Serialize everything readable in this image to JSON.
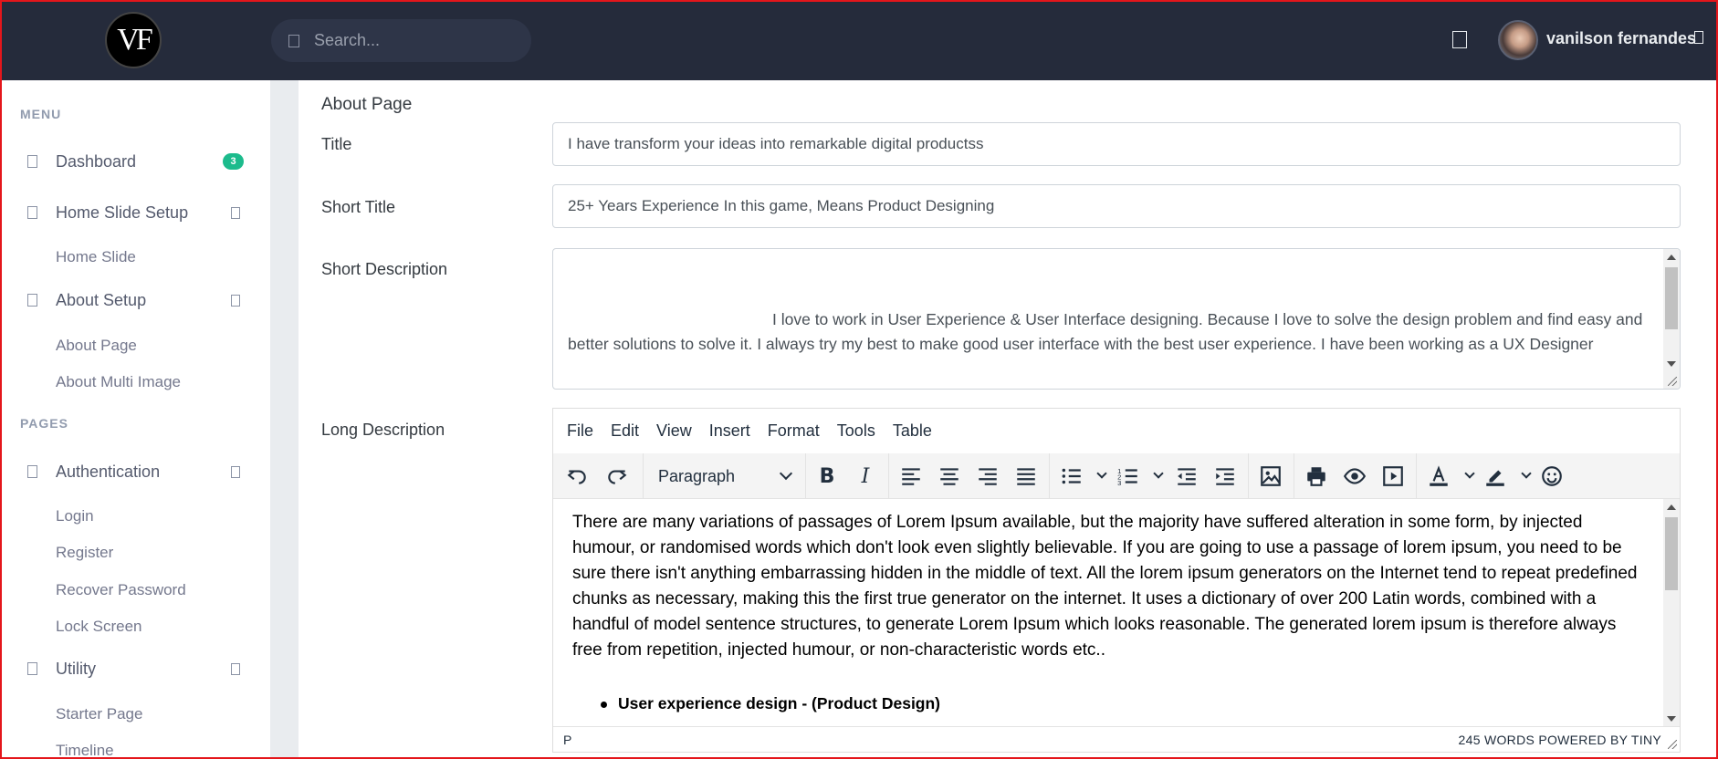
{
  "brand": {
    "logo_text": "VF"
  },
  "header": {
    "search_placeholder": "Search...",
    "user_name": "vanilson fernandes"
  },
  "sidebar": {
    "sections": [
      "MENU",
      "PAGES"
    ],
    "dashboard": {
      "label": "Dashboard",
      "badge": "3"
    },
    "home_slide_setup": {
      "label": "Home Slide Setup",
      "children": [
        "Home Slide"
      ]
    },
    "about_setup": {
      "label": "About Setup",
      "children": [
        "About Page",
        "About Multi Image"
      ]
    },
    "authentication": {
      "label": "Authentication",
      "children": [
        "Login",
        "Register",
        "Recover Password",
        "Lock Screen"
      ]
    },
    "utility": {
      "label": "Utility",
      "children": [
        "Starter Page",
        "Timeline"
      ]
    }
  },
  "form": {
    "card_title": "About Page",
    "title": {
      "label": "Title",
      "value": "I have transform your ideas into remarkable digital productss"
    },
    "short_title": {
      "label": "Short Title",
      "value": "25+ Years Experience In this game, Means Product Designing"
    },
    "short_description": {
      "label": "Short Description",
      "value": "I love to work in User Experience & User Interface designing. Because I love to solve the design problem and find easy and better solutions to solve it. I always try my best to make good user interface with the best user experience. I have been working as a UX Designer"
    },
    "long_description": {
      "label": "Long Description"
    }
  },
  "editor": {
    "menu": [
      "File",
      "Edit",
      "View",
      "Insert",
      "Format",
      "Tools",
      "Table"
    ],
    "block_format": "Paragraph",
    "content": "There are many variations of passages of Lorem Ipsum available, but the majority have suffered alteration in some form, by injected humour, or randomised words which don't look even slightly believable. If you are going to use a passage of lorem ipsum, you need to be sure there isn't anything embarrassing hidden in the middle of text. All the lorem ipsum generators on the Internet tend to repeat predefined chunks as necessary, making this the first true generator on the internet. It uses a dictionary of over 200 Latin words, combined with a handful of model sentence structures, to generate Lorem Ipsum which looks reasonable. The generated lorem ipsum is therefore always free from repetition, injected humour, or non-characteristic words etc..",
    "bullet_1": "User experience design - (Product Design)",
    "status_path": "P",
    "status_right": "245 WORDS  POWERED BY TINY"
  },
  "icons": [
    "search-icon",
    "fullscreen-icon",
    "user-caret-icon",
    "dashboard-icon",
    "chevron-icon",
    "undo-icon",
    "redo-icon",
    "bold-icon",
    "italic-icon",
    "align-left-icon",
    "align-center-icon",
    "align-right-icon",
    "justify-icon",
    "bullet-list-icon",
    "numbered-list-icon",
    "outdent-icon",
    "indent-icon",
    "image-icon",
    "print-icon",
    "preview-icon",
    "media-icon",
    "text-color-icon",
    "highlight-icon",
    "emoji-icon"
  ],
  "colors": {
    "topbar": "#252b3b",
    "badge": "#1cbb8c",
    "accent_border": "#e4161b"
  }
}
